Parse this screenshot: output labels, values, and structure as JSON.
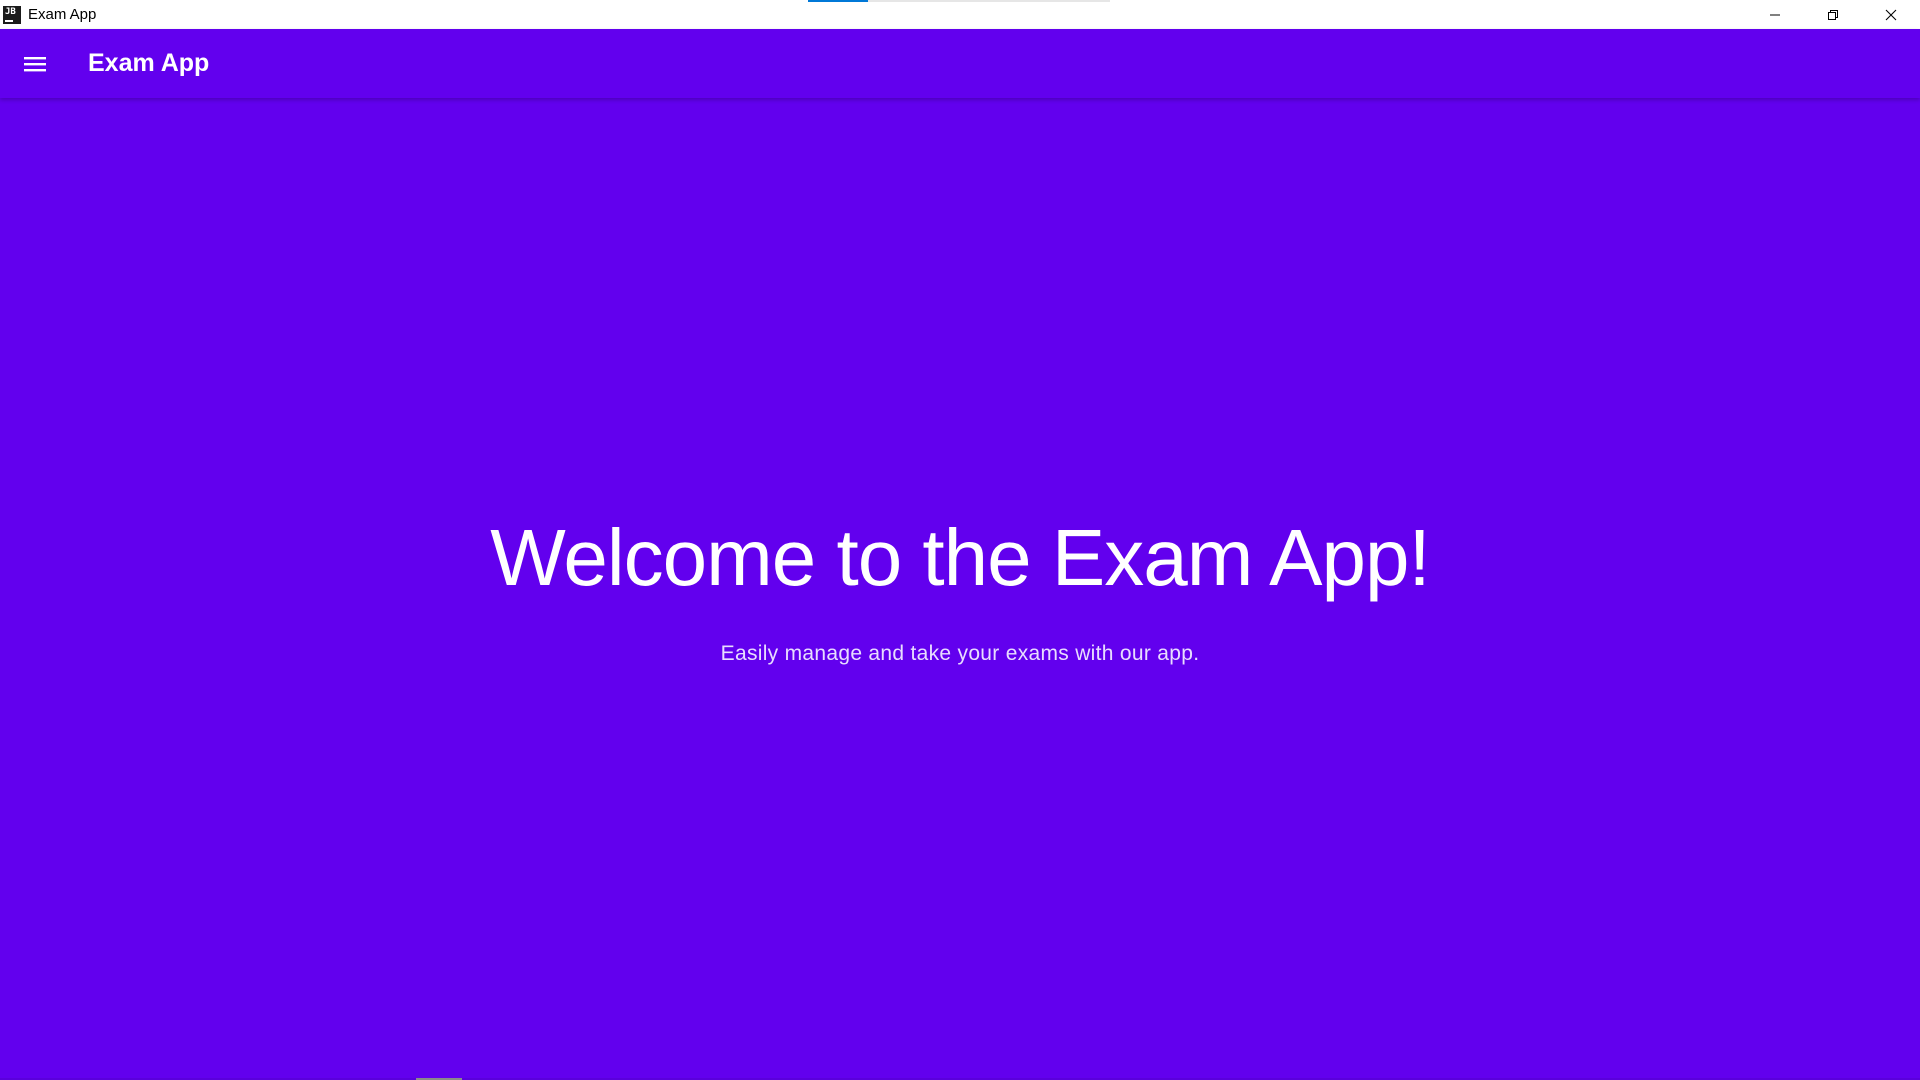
{
  "window": {
    "title": "Exam App",
    "app_icon_text": "JB",
    "loading_progress": 0.2
  },
  "appbar": {
    "title": "Exam App",
    "menu_icon": "hamburger-menu-icon"
  },
  "main": {
    "heading": "Welcome to the Exam App!",
    "subheading": "Easily manage and take your exams with our app."
  },
  "colors": {
    "primary": "#6200ee",
    "title_bar": "#ffffff",
    "text_on_primary": "#ffffff"
  }
}
